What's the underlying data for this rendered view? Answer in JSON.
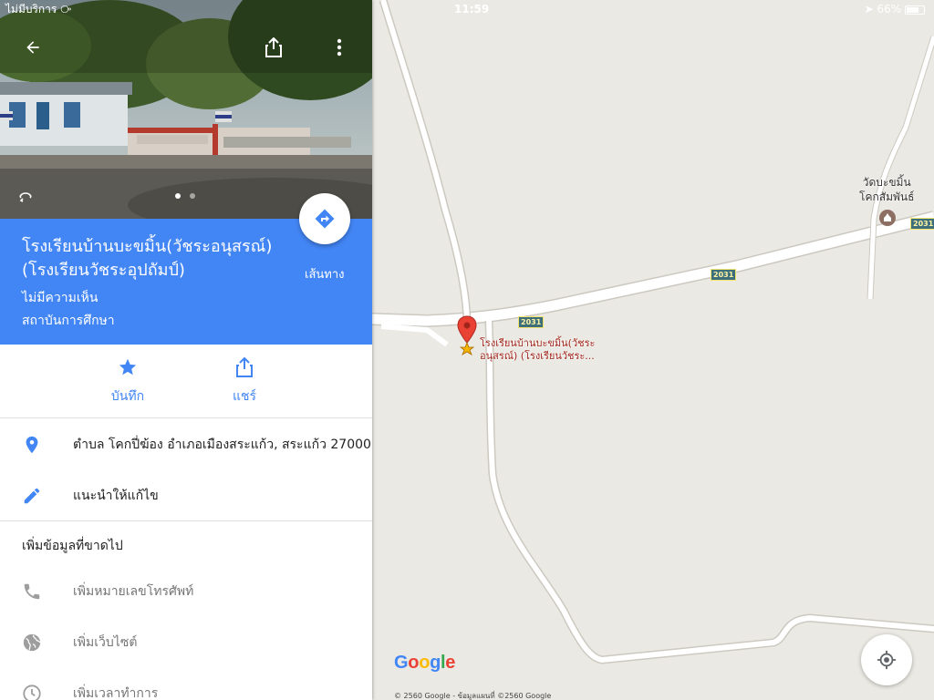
{
  "status_bar": {
    "carrier": "ไม่มีบริการ",
    "time": "11:59",
    "battery": "66%"
  },
  "place": {
    "title_line1": "โรงเรียนบ้านบะขมิ้น(วัชระอนุสรณ์)",
    "title_line2": "(โรงเรียนวัชระอุปถัมป์)",
    "reviews": "ไม่มีความเห็น",
    "category": "สถาบันการศึกษา",
    "directions_label": "เส้นทาง"
  },
  "actions": {
    "save_label": "บันทึก",
    "share_label": "แชร์"
  },
  "details": {
    "address": "ตำบล โคกปี่ฆ้อง อำเภอเมืองสระแก้ว, สระแก้ว 27000",
    "suggest_edit": "แนะนำให้แก้ไข"
  },
  "missing_info": {
    "heading": "เพิ่มข้อมูลที่ขาดไป",
    "add_phone": "เพิ่มหมายเลขโทรศัพท์",
    "add_website": "เพิ่มเว็บไซต์",
    "add_hours": "เพิ่มเวลาทำการ"
  },
  "map": {
    "route_number": "2031",
    "poi_name_line1": "วัดบะขมิ้น",
    "poi_name_line2": "โคกสัมพันธ์",
    "pin_label_line1": "โรงเรียนบ้านบะขมิ้น(วัชระ",
    "pin_label_line2": "อนุสรณ์) (โรงเรียนวัชระ...",
    "logo_letters": [
      "G",
      "o",
      "o",
      "g",
      "l",
      "e"
    ],
    "copyright": "© 2560 Google - ข้อมูลแผนที่ ©2560 Google"
  },
  "colors": {
    "header_blue": "#4285f4",
    "map_background": "#ebe9e3",
    "road": "#ffffff",
    "pin_red": "#e94235"
  },
  "icons": {
    "back": "arrow-left-icon",
    "share_top": "share-icon",
    "more": "more-vert-icon",
    "directions": "directions-turn-icon",
    "save": "star-icon",
    "share": "share-icon",
    "address": "location-pin-icon",
    "edit": "pencil-icon",
    "phone": "phone-icon",
    "website": "globe-icon",
    "hours": "clock-icon",
    "locate": "my-location-icon"
  }
}
